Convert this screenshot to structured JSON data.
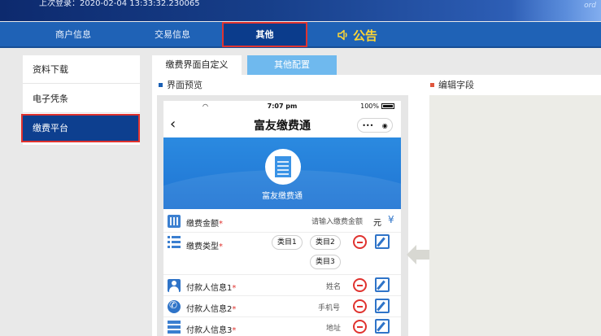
{
  "header": {
    "last_login": "上次登录：2020-02-04 13:33:32.230065",
    "deco_text": "ord"
  },
  "nav": {
    "merchant": "商户信息",
    "trade": "交易信息",
    "other": "其他",
    "notice": "公告"
  },
  "sidebar": {
    "items": [
      {
        "label": "资料下载"
      },
      {
        "label": "电子凭条"
      },
      {
        "label": "缴费平台"
      }
    ]
  },
  "tabs": {
    "custom": "缴费界面自定义",
    "config": "其他配置"
  },
  "sections": {
    "preview": "界面预览",
    "edit": "编辑字段"
  },
  "phone": {
    "time": "7:07 pm",
    "battery": "100%",
    "title": "富友缴费通",
    "hero_name": "富友缴费通",
    "fields": {
      "amount": {
        "label": "缴费金额",
        "required": "*",
        "placeholder": "请输入缴费金额",
        "unit": "元",
        "currency": "¥"
      },
      "type": {
        "label": "缴费类型",
        "required": "*",
        "options": [
          "类目1",
          "类目2",
          "类目3"
        ]
      },
      "payer1": {
        "label": "付款人信息1",
        "required": "*",
        "placeholder": "姓名"
      },
      "payer2": {
        "label": "付款人信息2",
        "required": "*",
        "placeholder": "手机号"
      },
      "payer3": {
        "label": "付款人信息3",
        "required": "*",
        "placeholder": "地址"
      }
    }
  },
  "colors": {
    "nav_blue": "#1f62b6",
    "active_blue": "#0d3f8f",
    "highlight_red": "#e0332f",
    "notice_yellow": "#ffd633",
    "tab_light_blue": "#6fb9ee"
  }
}
